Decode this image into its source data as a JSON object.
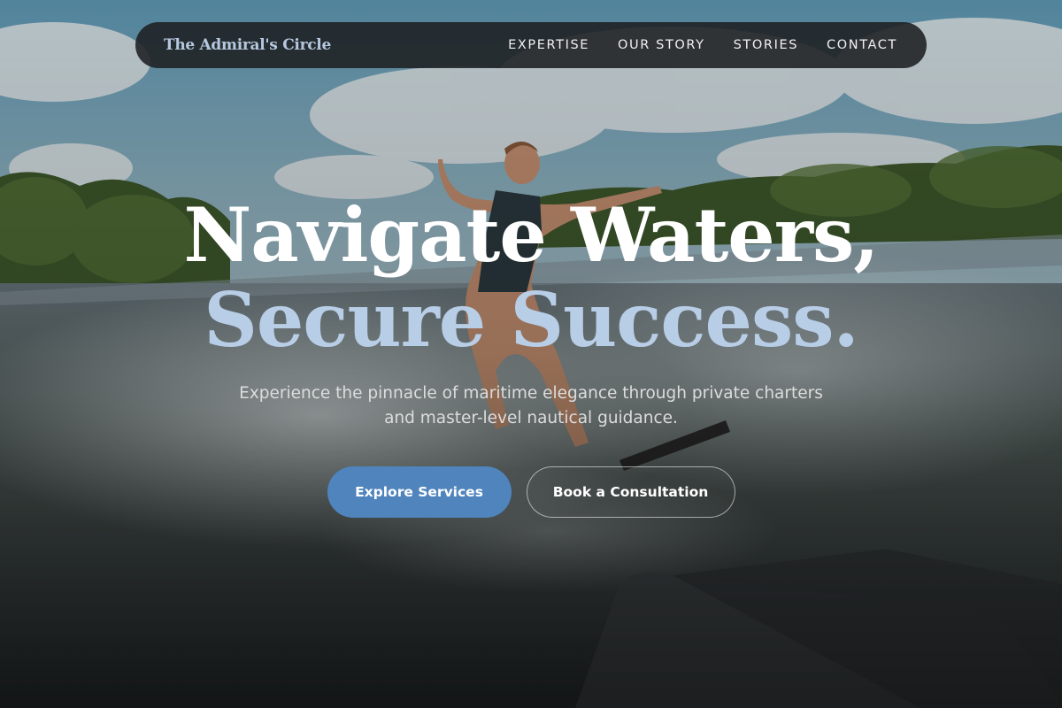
{
  "brand": {
    "name": "The Admiral's Circle"
  },
  "nav": {
    "links": [
      {
        "label": "EXPERTISE"
      },
      {
        "label": "OUR STORY"
      },
      {
        "label": "STORIES"
      },
      {
        "label": "CONTACT"
      }
    ]
  },
  "hero": {
    "headline_line1": "Navigate Waters,",
    "headline_line2": "Secure Success.",
    "subtitle_line1": "Experience the pinnacle of maritime elegance through private charters",
    "subtitle_line2": "and master-level nautical guidance.",
    "primary_cta": "Explore Services",
    "secondary_cta": "Book a Consultation"
  },
  "colors": {
    "accent": "#4f84bd",
    "headline_highlight": "#b8cde6",
    "nav_background": "#1e2022"
  },
  "background_image": "wakesurfer-on-lake-photo"
}
